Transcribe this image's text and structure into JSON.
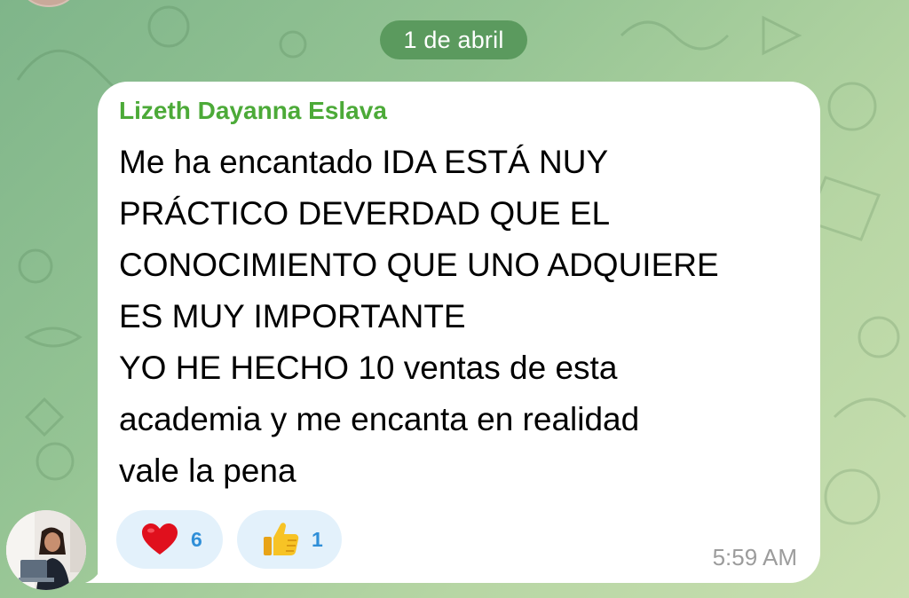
{
  "chat": {
    "date_divider": "1 de abril",
    "background_color": "#8fbf8f",
    "date_pill_color": "#5b9a5e"
  },
  "message": {
    "sender": "Lizeth Dayanna Eslava",
    "sender_color": "#4caa38",
    "text": "Me ha encantado IDA ESTÁ NUY\nPRÁCTICO DEVERDAD QUE EL\nCONOCIMIENTO QUE UNO ADQUIERE\nES MUY IMPORTANTE\nYO HE HECHO 10 ventas de esta\nacademia y me encanta en realidad\nvale la pena",
    "time": "5:59 AM",
    "reactions": [
      {
        "emoji": "red-heart-icon",
        "count": "6"
      },
      {
        "emoji": "thumbs-up-icon",
        "count": "1"
      }
    ],
    "reaction_count_color": "#2f8fd8"
  }
}
